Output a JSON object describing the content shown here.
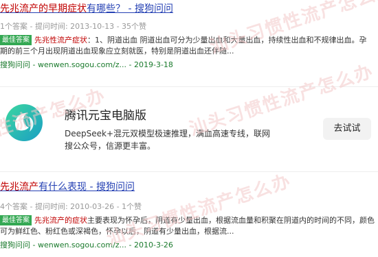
{
  "results": [
    {
      "title_highlight": "先兆流产的早期症状",
      "title_rest": "有哪些？ - 搜狗问问",
      "meta": "1个答案 - 提问时间: 2013-10-13 - 35个赞",
      "badge": "最佳答案",
      "body_highlight": "先兆性流产症状",
      "body_rest": "：1、阴道出血 阴道出血可分为少量出血和大量出血，持续性出血和不规律出血。孕期的前三个月出现阴道出血现象应立刻就医，特别是阴道出血还伴随...",
      "source": "搜狗问问 - wenwen.sogou.com/z... - 2019-3-18"
    },
    {
      "title_highlight": "先兆流产",
      "title_rest": "有什么表现 - 搜狗问问",
      "meta": "4个答案 - 提问时间: 2010-03-26 - 1个赞",
      "badge": "最佳答案",
      "body_highlight": "先兆流产的症状",
      "body_rest": "主要表现为怀孕后，阴道有少量出血，根据流血量和积聚在阴道内的时间的不同，颜色可为鲜红色、粉红色或深褐色，怀孕以后，阴道有少量出血，根据流...",
      "source": "搜狗问问 - wenwen.sogou.com/z... - 2010-3-26"
    }
  ],
  "ad": {
    "name": "腾讯元宝电脑版",
    "description": "DeepSeek+混元双模型极速推理，满血高速专线，联网搜公众号，信源更丰富。",
    "button_label": "去试试",
    "logo_icon": "yuanbao-logo-icon"
  },
  "watermark": {
    "text": "汕头习惯性流产怎么办"
  },
  "colors": {
    "link": "#2440b3",
    "highlight": "#c00000",
    "badge": "#34a853",
    "source": "#1a7a2c",
    "logo_teal": "#1fb5a6"
  }
}
